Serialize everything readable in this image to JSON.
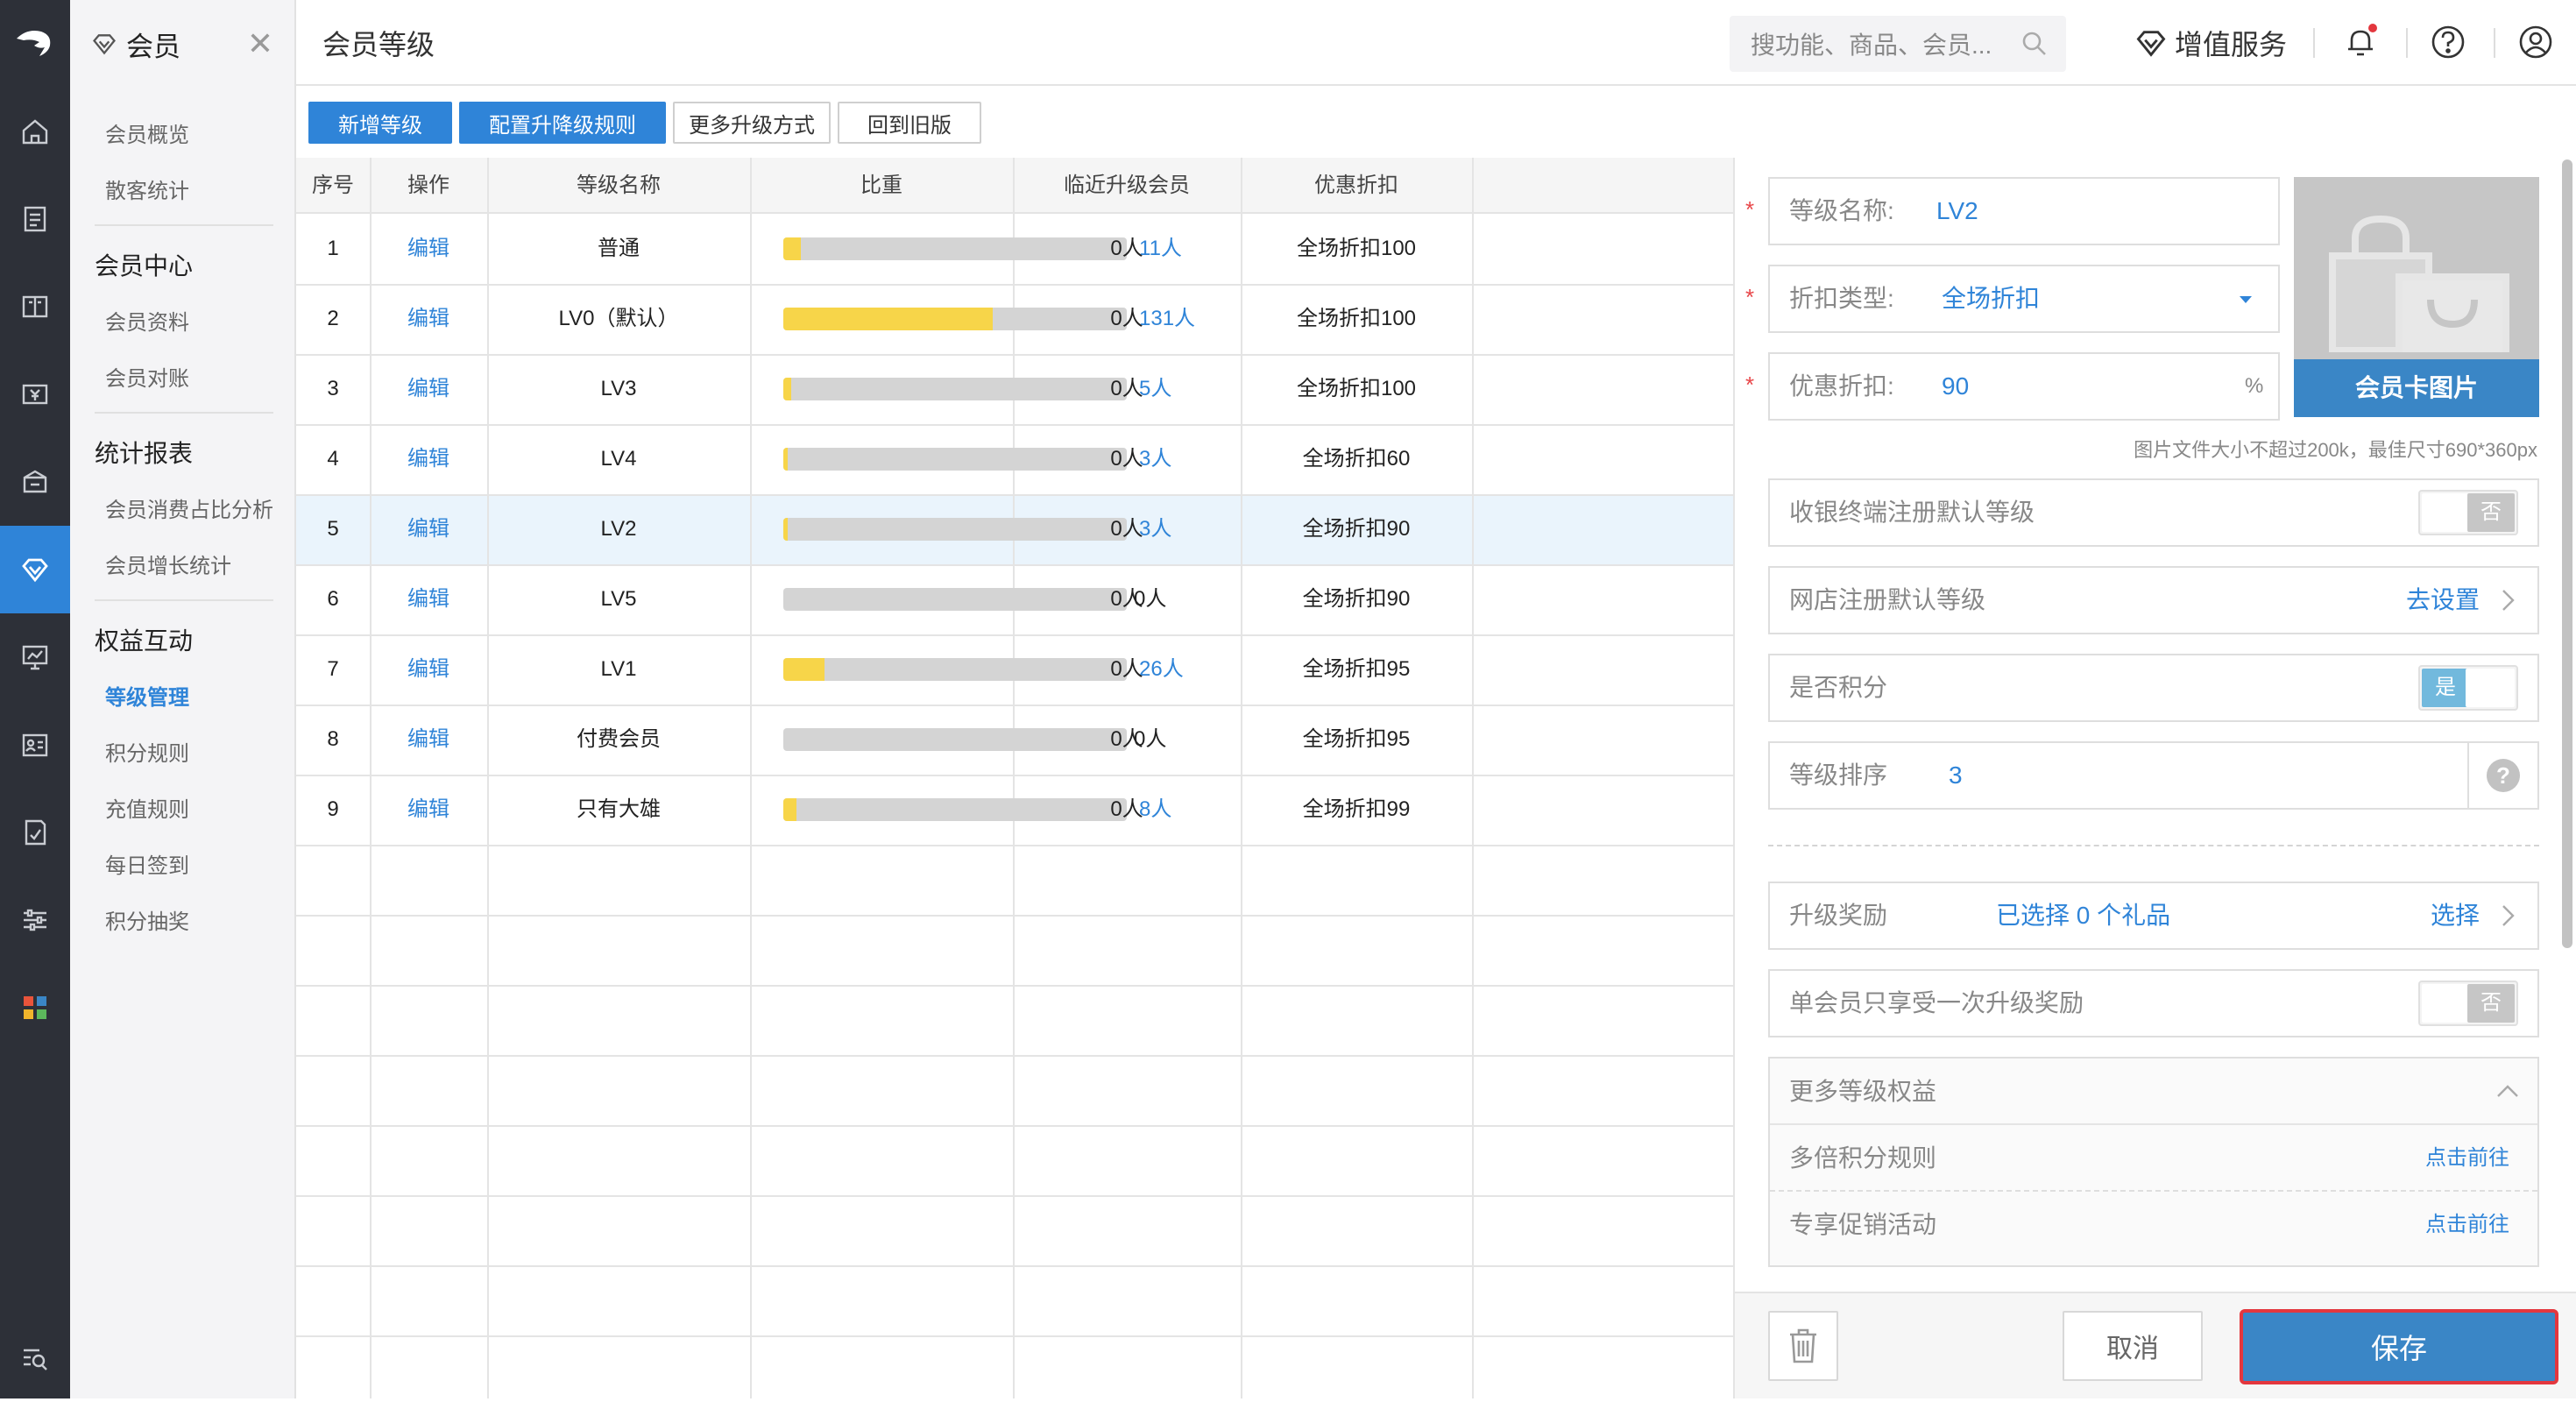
{
  "colors": {
    "accent": "#2f84d8",
    "rail": "#2d3038",
    "bar_fill": "#f7d549",
    "bar_track": "#d4d4d4",
    "highlight_row": "#eaf4fc",
    "save_border": "#e3373e"
  },
  "rail": {
    "icons": [
      "logo-icon",
      "home-icon",
      "notebook-icon",
      "book-icon",
      "money-icon",
      "box-icon",
      "diamond-icon",
      "monitor-chart-icon",
      "id-card-icon",
      "report-icon",
      "sliders-icon",
      "apps-grid-icon",
      "search-list-icon"
    ],
    "active": "diamond-icon"
  },
  "menu": {
    "title": "会员",
    "top_links": [
      "会员概览",
      "散客统计"
    ],
    "groups": [
      {
        "title": "会员中心",
        "items": [
          "会员资料",
          "会员对账"
        ]
      },
      {
        "title": "统计报表",
        "items": [
          "会员消费占比分析",
          "会员增长统计"
        ]
      },
      {
        "title": "权益互动",
        "items": [
          "等级管理",
          "积分规则",
          "充值规则",
          "每日签到",
          "积分抽奖"
        ]
      }
    ],
    "active_item": "等级管理"
  },
  "topbar": {
    "title": "会员等级",
    "search_placeholder": "搜功能、商品、会员...",
    "value_added": "增值服务"
  },
  "toolbar": {
    "add_level": "新增等级",
    "config_rules": "配置升降级规则",
    "more_upgrade": "更多升级方式",
    "old_version": "回到旧版"
  },
  "table": {
    "headers": [
      "序号",
      "操作",
      "等级名称",
      "比重",
      "临近升级会员",
      "优惠折扣"
    ],
    "selected_row": 5,
    "rows": [
      {
        "no": "1",
        "action": "编辑",
        "name": "普通",
        "weight_fraction": 0.05,
        "count": "11人",
        "count_link": true,
        "near": "0人",
        "discount": "全场折扣100"
      },
      {
        "no": "2",
        "action": "编辑",
        "name": "LV0（默认）",
        "weight_fraction": 0.61,
        "count": "131人",
        "count_link": true,
        "near": "0人",
        "discount": "全场折扣100"
      },
      {
        "no": "3",
        "action": "编辑",
        "name": "LV3",
        "weight_fraction": 0.023,
        "count": "5人",
        "count_link": true,
        "near": "0人",
        "discount": "全场折扣100"
      },
      {
        "no": "4",
        "action": "编辑",
        "name": "LV4",
        "weight_fraction": 0.014,
        "count": "3人",
        "count_link": true,
        "near": "0人",
        "discount": "全场折扣60"
      },
      {
        "no": "5",
        "action": "编辑",
        "name": "LV2",
        "weight_fraction": 0.014,
        "count": "3人",
        "count_link": true,
        "near": "0人",
        "discount": "全场折扣90"
      },
      {
        "no": "6",
        "action": "编辑",
        "name": "LV5",
        "weight_fraction": 0,
        "count": "0人",
        "count_link": false,
        "near": "0人",
        "discount": "全场折扣90"
      },
      {
        "no": "7",
        "action": "编辑",
        "name": "LV1",
        "weight_fraction": 0.12,
        "count": "26人",
        "count_link": true,
        "near": "0人",
        "discount": "全场折扣95"
      },
      {
        "no": "8",
        "action": "编辑",
        "name": "付费会员",
        "weight_fraction": 0,
        "count": "0人",
        "count_link": false,
        "near": "0人",
        "discount": "全场折扣95"
      },
      {
        "no": "9",
        "action": "编辑",
        "name": "只有大雄",
        "weight_fraction": 0.037,
        "count": "8人",
        "count_link": true,
        "near": "0人",
        "discount": "全场折扣99"
      }
    ]
  },
  "form": {
    "level_name_label": "等级名称:",
    "level_name": "LV2",
    "discount_type_label": "折扣类型:",
    "discount_type": "全场折扣",
    "discount_label": "优惠折扣:",
    "discount": "90",
    "discount_unit": "%",
    "card_image": "会员卡图片",
    "image_note": "图片文件大小不超过200k，最佳尺寸690*360px",
    "pos_default_label": "收银终端注册默认等级",
    "pos_default": "否",
    "web_default_label": "网店注册默认等级",
    "web_default_action": "去设置",
    "points_label": "是否积分",
    "points": "是",
    "sort_label": "等级排序",
    "sort": "3",
    "sort_help": "?",
    "reward_label": "升级奖励",
    "reward_value": "已选择 0 个礼品",
    "reward_action": "选择",
    "once_label": "单会员只享受一次升级奖励",
    "once": "否",
    "more_label": "更多等级权益",
    "multi_points_label": "多倍积分规则",
    "multi_points_action": "点击前往",
    "promo_label": "专享促销活动",
    "promo_action": "点击前往",
    "required_mark": "*"
  },
  "footer": {
    "cancel": "取消",
    "save": "保存"
  }
}
